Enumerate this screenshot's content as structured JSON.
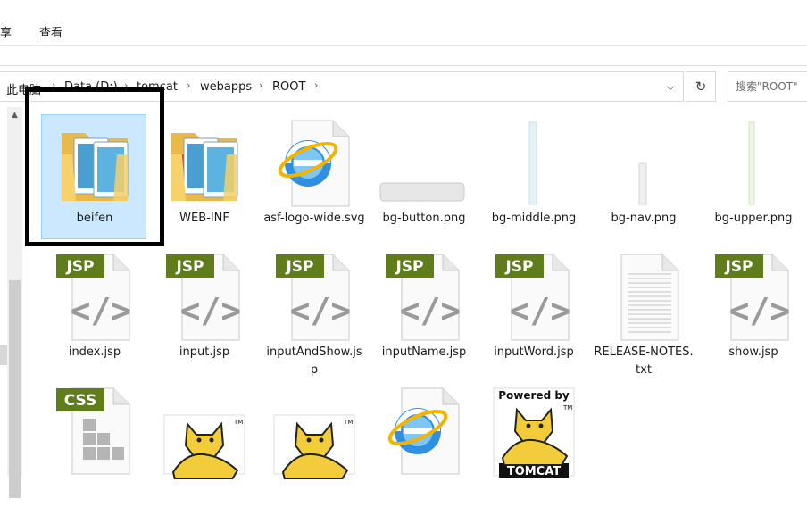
{
  "ribbon": {
    "tabs": [
      "享",
      "查看"
    ]
  },
  "address": {
    "crumbs": [
      "此电脑",
      "Data (D:)",
      "tomcat",
      "webapps",
      "ROOT"
    ]
  },
  "search": {
    "placeholder": "搜索\"ROOT\""
  },
  "files": [
    {
      "name": "beifen",
      "type": "folder",
      "selected": true
    },
    {
      "name": "WEB-INF",
      "type": "folder",
      "selected": false
    },
    {
      "name": "asf-logo-wide.svg",
      "type": "ie-file",
      "selected": false
    },
    {
      "name": "bg-button.png",
      "type": "png-thumb",
      "selected": false
    },
    {
      "name": "bg-middle.png",
      "type": "png-thumb",
      "selected": false
    },
    {
      "name": "bg-nav.png",
      "type": "png-thumb",
      "selected": false
    },
    {
      "name": "bg-upper.png",
      "type": "png-thumb",
      "selected": false
    },
    {
      "name": "index.jsp",
      "type": "jsp",
      "selected": false
    },
    {
      "name": "input.jsp",
      "type": "jsp",
      "selected": false
    },
    {
      "name": "inputAndShow.jsp",
      "type": "jsp",
      "selected": false
    },
    {
      "name": "inputName.jsp",
      "type": "jsp",
      "selected": false
    },
    {
      "name": "inputWord.jsp",
      "type": "jsp",
      "selected": false
    },
    {
      "name": "RELEASE-NOTES.txt",
      "type": "txt",
      "selected": false
    },
    {
      "name": "show.jsp",
      "type": "jsp",
      "selected": false
    },
    {
      "name": "",
      "type": "css",
      "selected": false
    },
    {
      "name": "",
      "type": "tomcat",
      "selected": false
    },
    {
      "name": "",
      "type": "tomcat",
      "selected": false
    },
    {
      "name": "",
      "type": "ie-file",
      "selected": false
    },
    {
      "name": "",
      "type": "tomcat-powered",
      "selected": false
    }
  ],
  "icon_text": {
    "jsp_badge": "JSP",
    "css_badge": "CSS",
    "powered_by": "Powered by",
    "tomcat": "TOMCAT",
    "tm": "TM"
  },
  "colors": {
    "selection_bg": "#cce8ff",
    "selection_border": "#99d1ff",
    "jsp_badge": "#5f7d1a",
    "folder": "#f7d26b",
    "highlight_box": "#000000"
  }
}
